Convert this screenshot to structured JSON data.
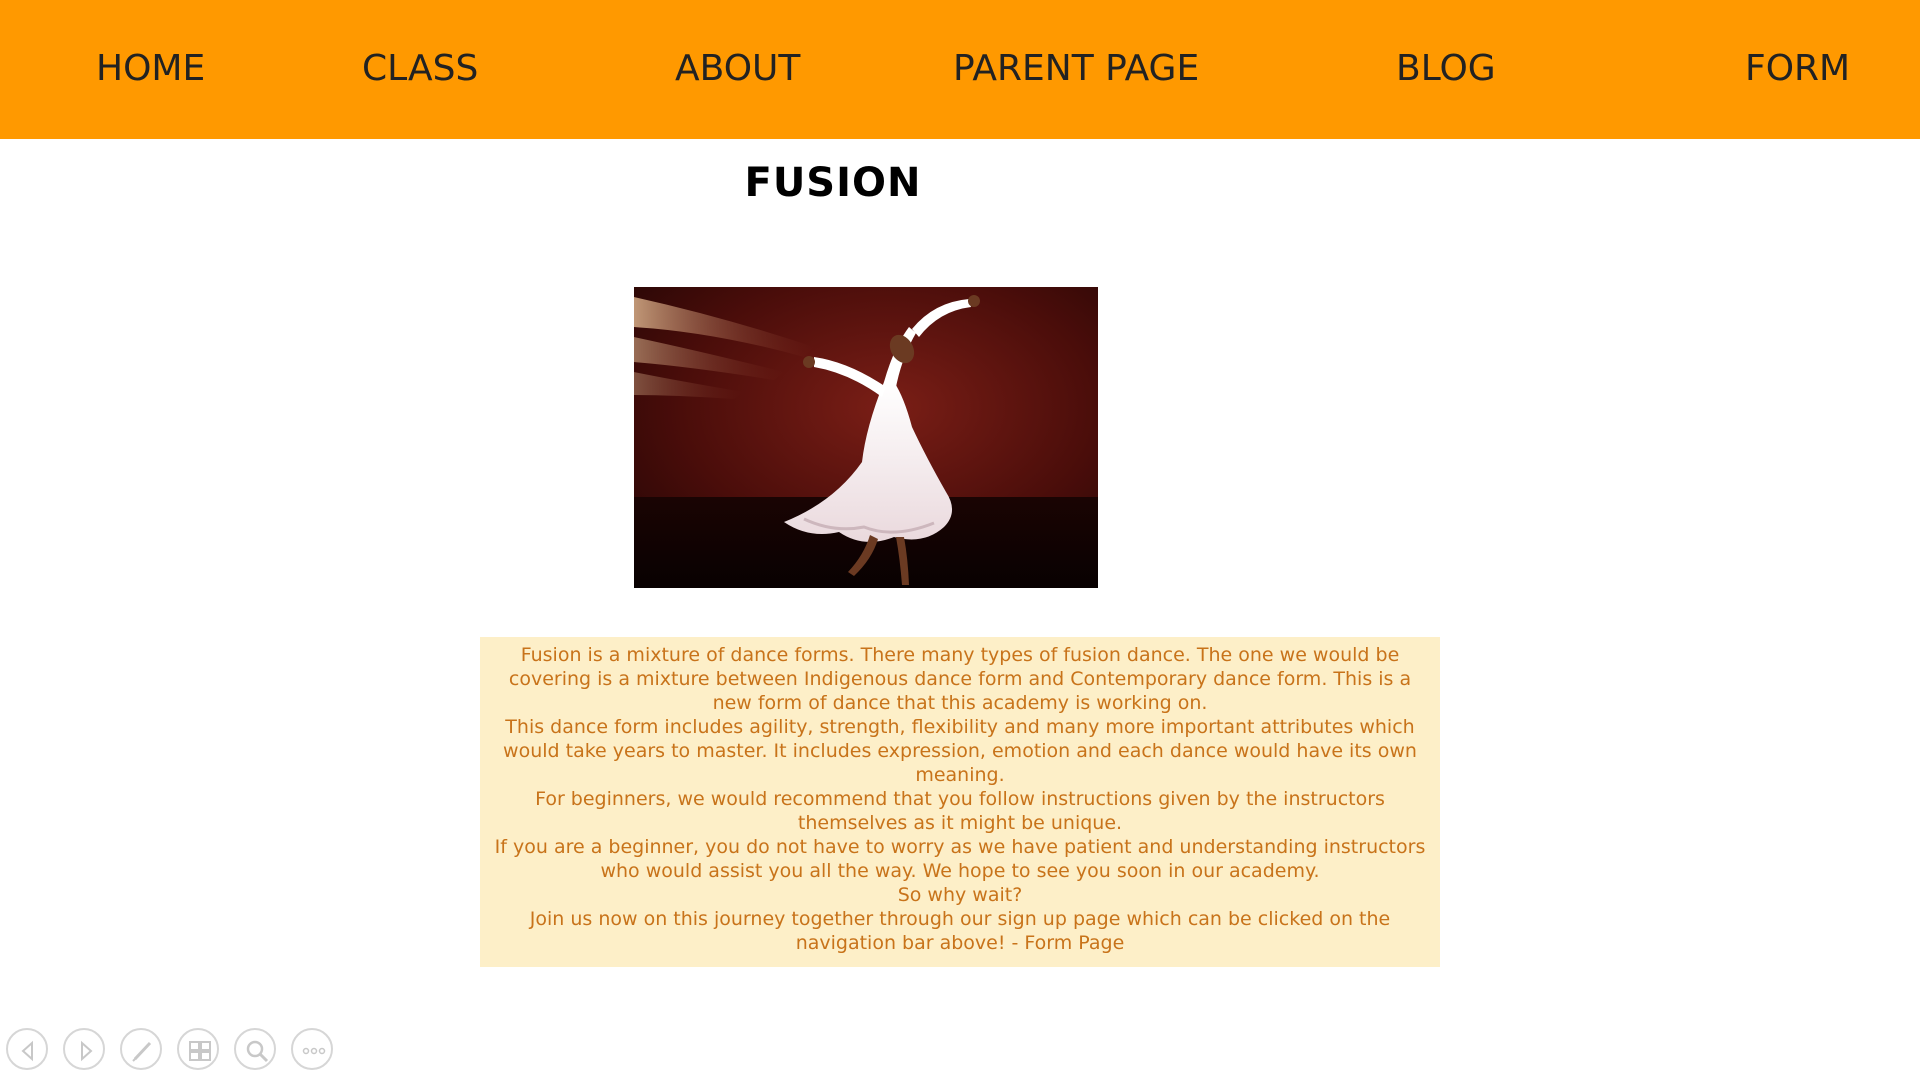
{
  "nav": {
    "items": [
      {
        "label": "HOME"
      },
      {
        "label": "CLASS"
      },
      {
        "label": "ABOUT"
      },
      {
        "label": "PARENT PAGE"
      },
      {
        "label": "BLOG"
      },
      {
        "label": "FORM"
      }
    ]
  },
  "main": {
    "title": "FUSION",
    "paragraphs": [
      "Fusion is a mixture of dance forms. There many types of fusion dance. The one we would be covering is a mixture between Indigenous dance form and Contemporary dance form. This is a new form of dance that this academy is working on.",
      "This dance form includes agility, strength, flexibility and many more important attributes which would take years to master. It includes expression, emotion and each dance would have its own meaning.",
      "For beginners, we would recommend that you follow instructions given by the instructors themselves as it might be unique.",
      "If you are a beginner, you do not have to worry as we have patient and understanding instructors who would assist you all the way. We hope to see you soon in our academy.",
      "So why wait?",
      "Join us now on this journey together through our sign up page which can be clicked on the navigation bar above! - Form Page"
    ]
  },
  "toolbar": {
    "icons": [
      "previous-icon",
      "next-icon",
      "pen-icon",
      "slides-icon",
      "zoom-icon",
      "more-icon"
    ]
  },
  "colors": {
    "nav_background": "#ff9900",
    "text_box_background": "#fdefc8",
    "body_text": "#c8731a"
  }
}
